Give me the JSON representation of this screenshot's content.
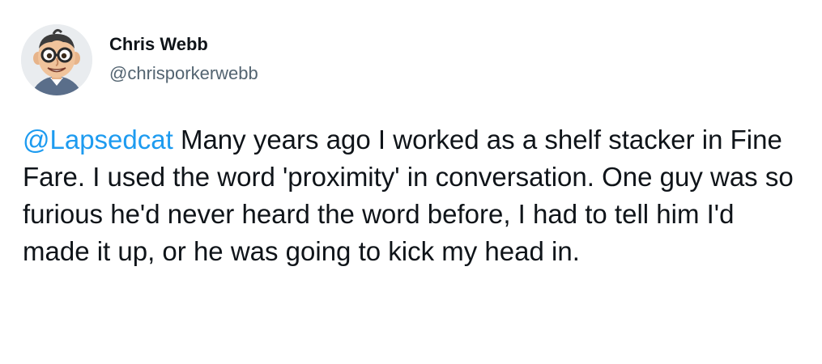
{
  "author": {
    "display_name": "Chris Webb",
    "handle": "@chrisporkerwebb",
    "avatar_icon": "cartoon-face-with-glasses-avatar"
  },
  "tweet": {
    "mention": "@Lapsedcat",
    "text": " Many years ago I worked as a shelf stacker in Fine Fare. I used the word 'proximity' in conversation. One guy was so furious he'd never heard the word before, I had to tell him I'd made it up, or he was going to kick my head in."
  },
  "colors": {
    "mention": "#1d9bf0",
    "text": "#0f1419",
    "handle": "#536471"
  }
}
